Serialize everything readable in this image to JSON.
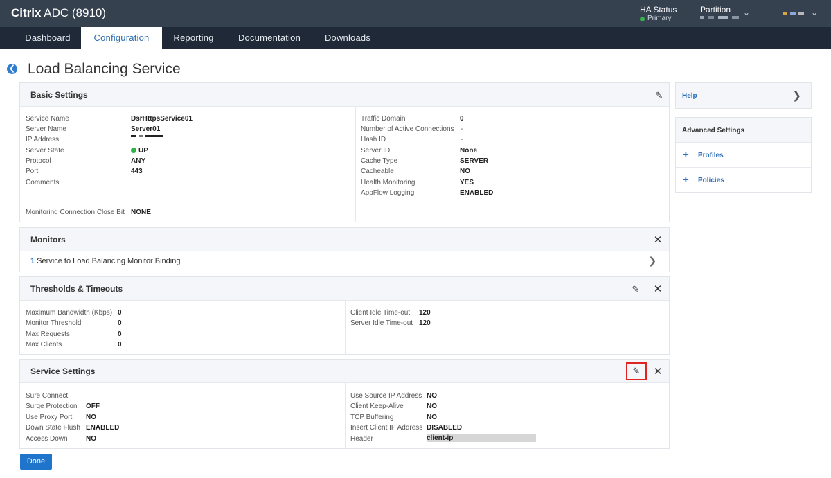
{
  "app": {
    "brand_bold": "Citrix",
    "brand_rest": " ADC (8910)"
  },
  "top_right": {
    "ha_label": "HA Status",
    "ha_value": "Primary",
    "partition_label": "Partition"
  },
  "nav": [
    "Dashboard",
    "Configuration",
    "Reporting",
    "Documentation",
    "Downloads"
  ],
  "page_title": "Load Balancing Service",
  "basic": {
    "title": "Basic Settings",
    "left": [
      {
        "k": "Service Name",
        "v": "DsrHttpsService01"
      },
      {
        "k": "Server Name",
        "v": "Server01"
      },
      {
        "k": "IP Address",
        "v": ""
      },
      {
        "k": "Server State",
        "v": "UP"
      },
      {
        "k": "Protocol",
        "v": "ANY"
      },
      {
        "k": "Port",
        "v": "443"
      },
      {
        "k": "Comments",
        "v": ""
      }
    ],
    "monitor_close": {
      "k": "Monitoring Connection Close Bit",
      "v": "NONE"
    },
    "right": [
      {
        "k": "Traffic Domain",
        "v": "0"
      },
      {
        "k": "Number of Active Connections",
        "v": "-"
      },
      {
        "k": "Hash ID",
        "v": "-"
      },
      {
        "k": "Server ID",
        "v": "None"
      },
      {
        "k": "Cache Type",
        "v": "SERVER"
      },
      {
        "k": "Cacheable",
        "v": "NO"
      },
      {
        "k": "Health Monitoring",
        "v": "YES"
      },
      {
        "k": "AppFlow Logging",
        "v": "ENABLED"
      }
    ]
  },
  "monitors": {
    "title": "Monitors",
    "count": "1",
    "link_text": " Service to Load Balancing Monitor Binding"
  },
  "thresholds": {
    "title": "Thresholds & Timeouts",
    "left": [
      {
        "k": "Maximum Bandwidth (Kbps)",
        "v": "0"
      },
      {
        "k": "Monitor Threshold",
        "v": "0"
      },
      {
        "k": "Max Requests",
        "v": "0"
      },
      {
        "k": "Max Clients",
        "v": "0"
      }
    ],
    "right": [
      {
        "k": "Client Idle Time-out",
        "v": "120"
      },
      {
        "k": "Server Idle Time-out",
        "v": "120"
      }
    ]
  },
  "service": {
    "title": "Service Settings",
    "left": [
      {
        "k": "Sure Connect",
        "v": ""
      },
      {
        "k": "Surge Protection",
        "v": "OFF"
      },
      {
        "k": "Use Proxy Port",
        "v": "NO"
      },
      {
        "k": "Down State Flush",
        "v": "ENABLED"
      },
      {
        "k": "Access Down",
        "v": "NO"
      }
    ],
    "right": [
      {
        "k": "Use Source IP Address",
        "v": "NO"
      },
      {
        "k": "Client Keep-Alive",
        "v": "NO"
      },
      {
        "k": "TCP Buffering",
        "v": "NO"
      },
      {
        "k": "Insert Client IP Address",
        "v": "DISABLED"
      },
      {
        "k": "Header",
        "v": "client-ip"
      }
    ]
  },
  "side": {
    "help": "Help",
    "advanced_title": "Advanced Settings",
    "items": [
      "Profiles",
      "Policies"
    ]
  },
  "done_label": "Done",
  "icons": {
    "edit": "pencil-icon",
    "close": "close-icon",
    "back": "back-arrow-icon"
  },
  "colors": {
    "accent": "#2f7cd0",
    "topbar": "#364150",
    "navbar": "#1f2937",
    "up": "#2fb344",
    "highlight": "#e02424"
  }
}
